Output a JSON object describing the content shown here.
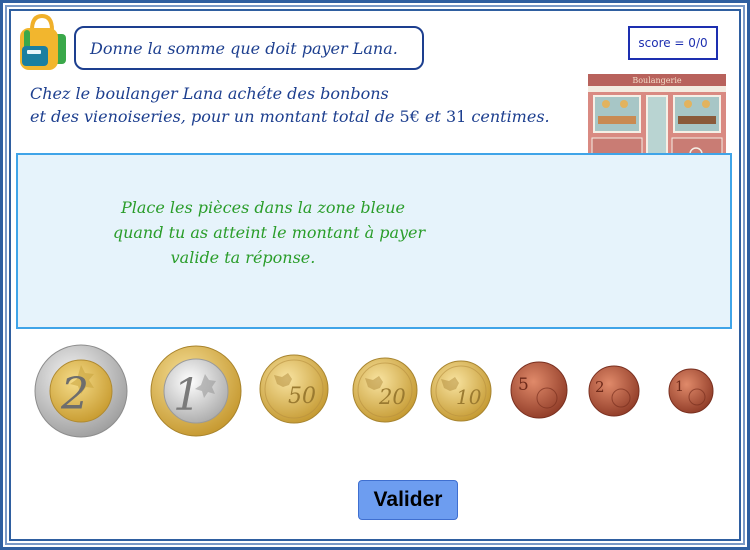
{
  "header": {
    "instruction": "Donne la somme que doit payer Lana.",
    "score": "score = 0/0"
  },
  "problem": {
    "line1": "Chez le boulanger Lana achéte des bonbons",
    "line2_start": "et des vienoiseries, pour un montant total de ",
    "amount": "5€",
    "line2_middle": " et ",
    "cents": "31",
    "line2_end": " centimes."
  },
  "bakery": {
    "sign": "Boulangerie"
  },
  "drop_zone": {
    "line1": "Place les pièces dans la zone bleue",
    "line2": "quand tu as atteint le montant à payer",
    "line3": "valide ta réponse."
  },
  "coins": [
    {
      "denomination": "2",
      "unit": "euro",
      "metal": "bimetal-silver-rim"
    },
    {
      "denomination": "1",
      "unit": "euro",
      "metal": "bimetal-gold-rim"
    },
    {
      "denomination": "50",
      "unit": "cent",
      "metal": "nordic-gold"
    },
    {
      "denomination": "20",
      "unit": "cent",
      "metal": "nordic-gold"
    },
    {
      "denomination": "10",
      "unit": "cent",
      "metal": "nordic-gold"
    },
    {
      "denomination": "5",
      "unit": "cent",
      "metal": "copper"
    },
    {
      "denomination": "2",
      "unit": "cent",
      "metal": "copper"
    },
    {
      "denomination": "1",
      "unit": "cent",
      "metal": "copper"
    }
  ],
  "buttons": {
    "valider": "Valider"
  },
  "colors": {
    "frame": "#2f5fa0",
    "title_text": "#1d3f8f",
    "zone_fill": "#e6f3fb",
    "zone_border": "#3fa4e8",
    "zone_text": "#2a9d2a",
    "button_fill": "#6d9df0"
  }
}
